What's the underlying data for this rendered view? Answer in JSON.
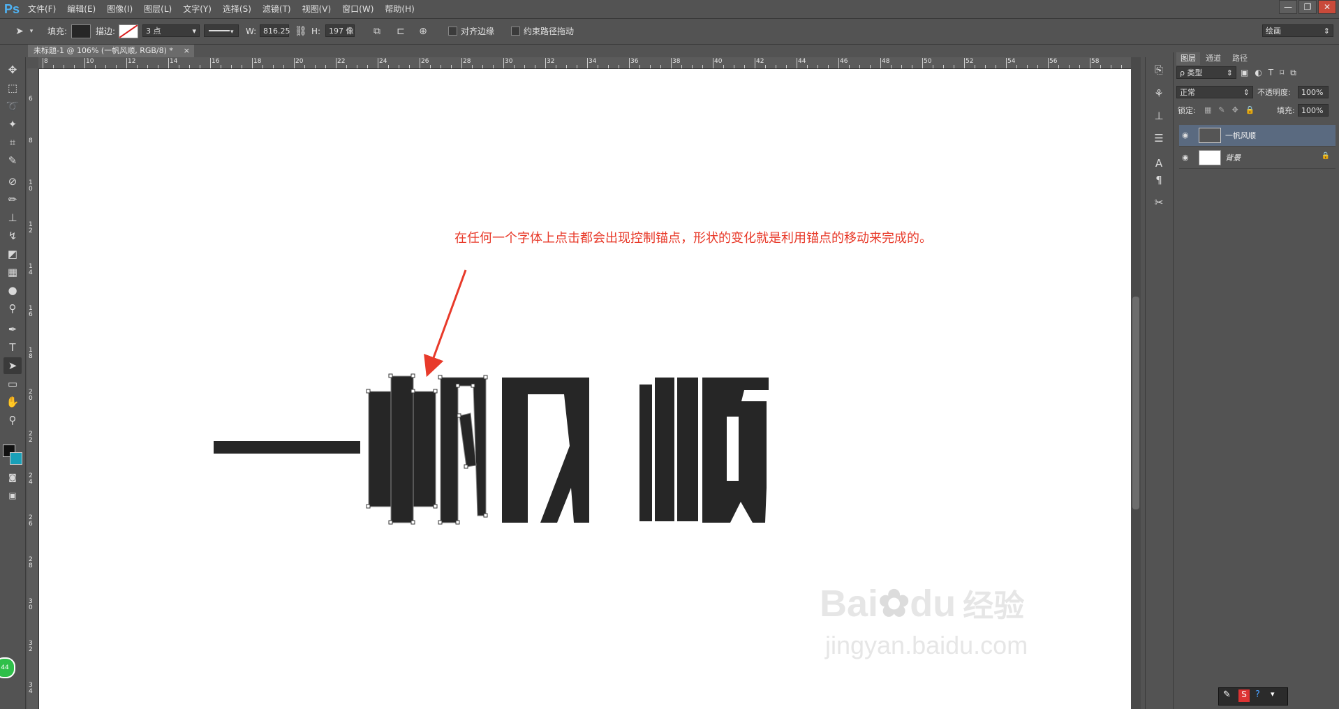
{
  "app": {
    "logo": "Ps"
  },
  "menu": [
    "文件(F)",
    "编辑(E)",
    "图像(I)",
    "图层(L)",
    "文字(Y)",
    "选择(S)",
    "滤镜(T)",
    "视图(V)",
    "窗口(W)",
    "帮助(H)"
  ],
  "window_controls": {
    "minimize": "—",
    "restore": "❐",
    "close": "✕"
  },
  "options": {
    "fill_label": "填充:",
    "stroke_label": "描边:",
    "stroke_size": "3 点",
    "w_label": "W:",
    "w_value": "816.25",
    "h_label": "H:",
    "h_value": "197 像",
    "align_edges_label": "对齐边缘",
    "constrain_path_label": "约束路径拖动",
    "workspace": "绘画",
    "fill_color": "#262626",
    "stroke_color": "#d92020"
  },
  "document_tab": {
    "title": "未标题-1 @ 106% (一帆风顺, RGB/8) *",
    "close": "×"
  },
  "ruler_top": [
    "8",
    "10",
    "12",
    "14",
    "16",
    "18",
    "20",
    "22",
    "24",
    "26",
    "28",
    "30",
    "32",
    "34",
    "36",
    "38",
    "40",
    "42",
    "44",
    "46",
    "48",
    "50",
    "52",
    "54",
    "56",
    "58"
  ],
  "ruler_left": [
    "6",
    "8",
    "10",
    "12",
    "14",
    "16",
    "18",
    "20",
    "22",
    "24",
    "26",
    "28",
    "30",
    "32",
    "34"
  ],
  "canvas": {
    "annotation": "在任何一个字体上点击都会出现控制锚点，形状的变化就是利用锚点的移动来完成的。",
    "annotation_color": "#e83a2a",
    "artwork_text": "一帆风顺",
    "artwork_color": "#262626"
  },
  "layers_panel": {
    "tabs": [
      "图层",
      "通道",
      "路径"
    ],
    "kind_label": "ρ 类型",
    "blend_mode": "正常",
    "opacity_label": "不透明度:",
    "opacity_value": "100%",
    "lock_label": "锁定:",
    "fill_label": "填充:",
    "fill_value": "100%",
    "layers": [
      {
        "name": "一帆风顺",
        "selected": true
      },
      {
        "name": "背景",
        "selected": false,
        "locked": true
      }
    ]
  },
  "watermark": {
    "brand": "Bai",
    "brand2": "du",
    "product": "经验",
    "url": "jingyan.baidu.com"
  },
  "badge": "44"
}
